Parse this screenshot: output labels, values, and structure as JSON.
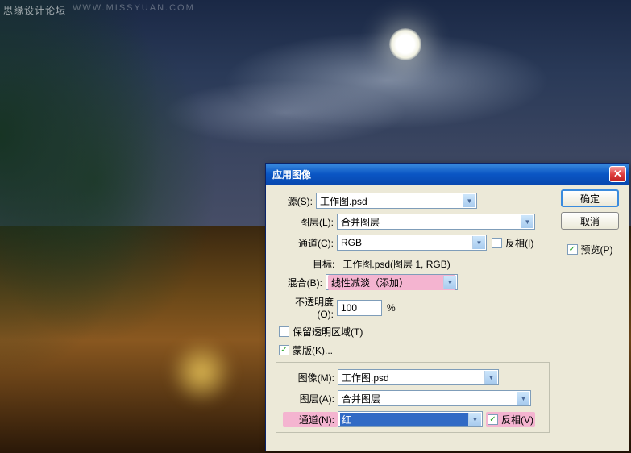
{
  "watermark": {
    "text": "思缘设计论坛",
    "url": "WWW.MISSYUAN.COM"
  },
  "dialog": {
    "title": "应用图像",
    "source": {
      "label": "源(S):",
      "value": "工作图.psd"
    },
    "layer": {
      "label": "图层(L):",
      "value": "合并图层"
    },
    "channel": {
      "label": "通道(C):",
      "value": "RGB",
      "invert_label": "反相(I)"
    },
    "target": {
      "label": "目标:",
      "value": "工作图.psd(图层 1, RGB)"
    },
    "blend": {
      "label": "混合(B):",
      "value": "线性减淡（添加）"
    },
    "opacity": {
      "label": "不透明度(O):",
      "value": "100",
      "pct": "%"
    },
    "preserve": {
      "label": "保留透明区域(T)"
    },
    "mask": {
      "label": "蒙版(K)...",
      "image": {
        "label": "图像(M):",
        "value": "工作图.psd"
      },
      "layer": {
        "label": "图层(A):",
        "value": "合并图层"
      },
      "channel": {
        "label": "通道(N):",
        "value": "红",
        "invert_label": "反相(V)"
      }
    },
    "buttons": {
      "ok": "确定",
      "cancel": "取消",
      "preview": "预览(P)"
    }
  }
}
